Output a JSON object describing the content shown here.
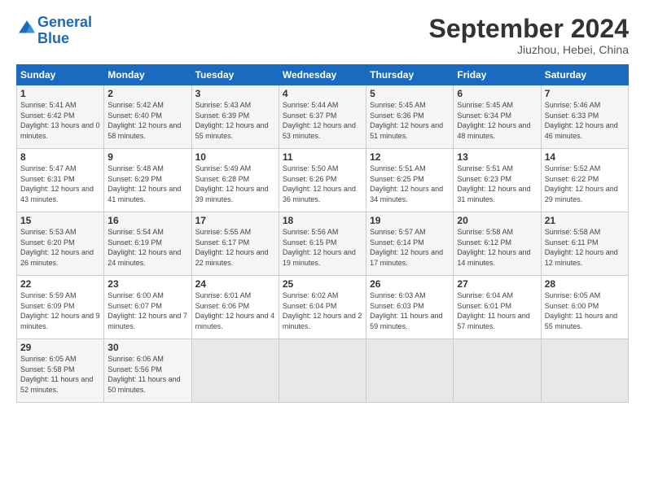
{
  "header": {
    "logo_line1": "General",
    "logo_line2": "Blue",
    "month_title": "September 2024",
    "location": "Jiuzhou, Hebei, China"
  },
  "weekdays": [
    "Sunday",
    "Monday",
    "Tuesday",
    "Wednesday",
    "Thursday",
    "Friday",
    "Saturday"
  ],
  "weeks": [
    [
      {
        "day": "1",
        "rise": "5:41 AM",
        "set": "6:42 PM",
        "daylight": "13 hours and 0 minutes."
      },
      {
        "day": "2",
        "rise": "5:42 AM",
        "set": "6:40 PM",
        "daylight": "12 hours and 58 minutes."
      },
      {
        "day": "3",
        "rise": "5:43 AM",
        "set": "6:39 PM",
        "daylight": "12 hours and 55 minutes."
      },
      {
        "day": "4",
        "rise": "5:44 AM",
        "set": "6:37 PM",
        "daylight": "12 hours and 53 minutes."
      },
      {
        "day": "5",
        "rise": "5:45 AM",
        "set": "6:36 PM",
        "daylight": "12 hours and 51 minutes."
      },
      {
        "day": "6",
        "rise": "5:45 AM",
        "set": "6:34 PM",
        "daylight": "12 hours and 48 minutes."
      },
      {
        "day": "7",
        "rise": "5:46 AM",
        "set": "6:33 PM",
        "daylight": "12 hours and 46 minutes."
      }
    ],
    [
      {
        "day": "8",
        "rise": "5:47 AM",
        "set": "6:31 PM",
        "daylight": "12 hours and 43 minutes."
      },
      {
        "day": "9",
        "rise": "5:48 AM",
        "set": "6:29 PM",
        "daylight": "12 hours and 41 minutes."
      },
      {
        "day": "10",
        "rise": "5:49 AM",
        "set": "6:28 PM",
        "daylight": "12 hours and 39 minutes."
      },
      {
        "day": "11",
        "rise": "5:50 AM",
        "set": "6:26 PM",
        "daylight": "12 hours and 36 minutes."
      },
      {
        "day": "12",
        "rise": "5:51 AM",
        "set": "6:25 PM",
        "daylight": "12 hours and 34 minutes."
      },
      {
        "day": "13",
        "rise": "5:51 AM",
        "set": "6:23 PM",
        "daylight": "12 hours and 31 minutes."
      },
      {
        "day": "14",
        "rise": "5:52 AM",
        "set": "6:22 PM",
        "daylight": "12 hours and 29 minutes."
      }
    ],
    [
      {
        "day": "15",
        "rise": "5:53 AM",
        "set": "6:20 PM",
        "daylight": "12 hours and 26 minutes."
      },
      {
        "day": "16",
        "rise": "5:54 AM",
        "set": "6:19 PM",
        "daylight": "12 hours and 24 minutes."
      },
      {
        "day": "17",
        "rise": "5:55 AM",
        "set": "6:17 PM",
        "daylight": "12 hours and 22 minutes."
      },
      {
        "day": "18",
        "rise": "5:56 AM",
        "set": "6:15 PM",
        "daylight": "12 hours and 19 minutes."
      },
      {
        "day": "19",
        "rise": "5:57 AM",
        "set": "6:14 PM",
        "daylight": "12 hours and 17 minutes."
      },
      {
        "day": "20",
        "rise": "5:58 AM",
        "set": "6:12 PM",
        "daylight": "12 hours and 14 minutes."
      },
      {
        "day": "21",
        "rise": "5:58 AM",
        "set": "6:11 PM",
        "daylight": "12 hours and 12 minutes."
      }
    ],
    [
      {
        "day": "22",
        "rise": "5:59 AM",
        "set": "6:09 PM",
        "daylight": "12 hours and 9 minutes."
      },
      {
        "day": "23",
        "rise": "6:00 AM",
        "set": "6:07 PM",
        "daylight": "12 hours and 7 minutes."
      },
      {
        "day": "24",
        "rise": "6:01 AM",
        "set": "6:06 PM",
        "daylight": "12 hours and 4 minutes."
      },
      {
        "day": "25",
        "rise": "6:02 AM",
        "set": "6:04 PM",
        "daylight": "12 hours and 2 minutes."
      },
      {
        "day": "26",
        "rise": "6:03 AM",
        "set": "6:03 PM",
        "daylight": "11 hours and 59 minutes."
      },
      {
        "day": "27",
        "rise": "6:04 AM",
        "set": "6:01 PM",
        "daylight": "11 hours and 57 minutes."
      },
      {
        "day": "28",
        "rise": "6:05 AM",
        "set": "6:00 PM",
        "daylight": "11 hours and 55 minutes."
      }
    ],
    [
      {
        "day": "29",
        "rise": "6:05 AM",
        "set": "5:58 PM",
        "daylight": "11 hours and 52 minutes."
      },
      {
        "day": "30",
        "rise": "6:06 AM",
        "set": "5:56 PM",
        "daylight": "11 hours and 50 minutes."
      },
      null,
      null,
      null,
      null,
      null
    ]
  ]
}
